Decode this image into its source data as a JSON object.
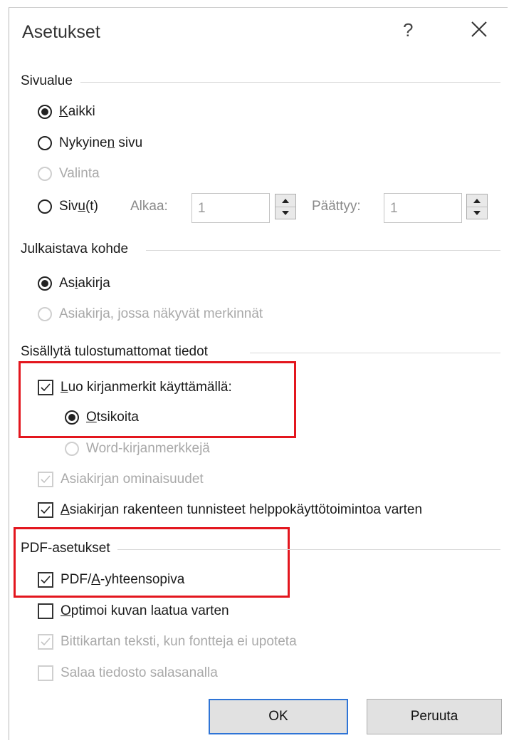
{
  "dialog": {
    "title": "Asetukset",
    "help_label": "?",
    "close_icon": "close-icon"
  },
  "page_range": {
    "label": "Sivualue",
    "all": {
      "pre": "",
      "key": "K",
      "post": "aikki",
      "checked": true
    },
    "current": {
      "pre": "Nykyine",
      "key": "n",
      "post": " sivu",
      "checked": false
    },
    "selection": {
      "label": "Valinta",
      "enabled": false
    },
    "pages": {
      "pre": "Siv",
      "key": "u",
      "post": "(t)",
      "checked": false
    },
    "from_label": "Alkaa:",
    "from_value": "1",
    "to_label": "Päättyy:",
    "to_value": "1"
  },
  "publish": {
    "label": "Julkaistava kohde",
    "document": {
      "pre": "As",
      "key": "i",
      "post": "akirja",
      "checked": true
    },
    "document_markup": {
      "label": "Asiakirja, jossa näkyvät merkinnät",
      "enabled": false
    }
  },
  "nonprint": {
    "label": "Sisällytä tulostumattomat tiedot",
    "create_bookmarks": {
      "pre": "",
      "key": "L",
      "post": "uo kirjanmerkit käyttämällä:",
      "checked": true
    },
    "headings": {
      "pre": "",
      "key": "O",
      "post": "tsikoita",
      "checked": true
    },
    "word_bookmarks": {
      "label": "Word-kirjanmerkkejä",
      "enabled": false
    },
    "doc_properties": {
      "label": "Asiakirjan ominaisuudet",
      "checked": true,
      "enabled": false
    },
    "structure_tags": {
      "pre": "",
      "key": "A",
      "post": "siakirjan rakenteen tunnisteet helppokäyttötoimintoa varten",
      "checked": true
    }
  },
  "pdf": {
    "label": "PDF-asetukset",
    "pdfa": {
      "pre": "PDF/",
      "key": "A",
      "post": "-yhteensopiva",
      "checked": true
    },
    "optimize": {
      "pre": "",
      "key": "O",
      "post": "ptimoi kuvan laatua varten",
      "checked": false
    },
    "bitmap_text": {
      "label": "Bittikartan teksti, kun fontteja ei upoteta",
      "checked": true,
      "enabled": false
    },
    "encrypt": {
      "label": "Salaa tiedosto salasanalla",
      "checked": false,
      "enabled": false
    }
  },
  "buttons": {
    "ok": "OK",
    "cancel": "Peruuta"
  },
  "colors": {
    "highlight": "#e3161e",
    "primary_border": "#2f74d6"
  }
}
